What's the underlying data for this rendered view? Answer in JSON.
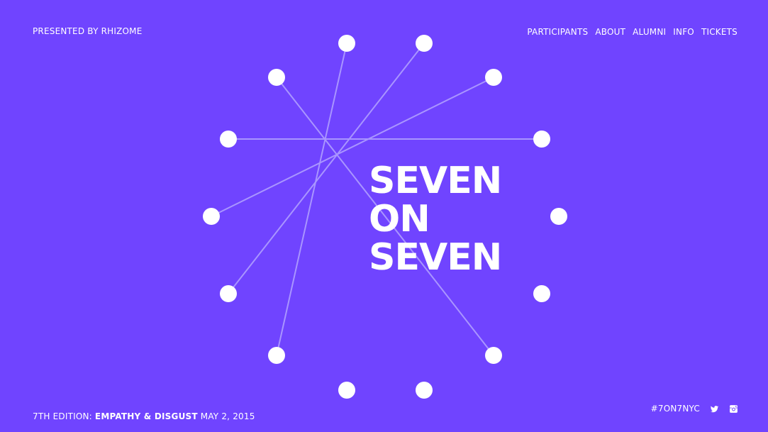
{
  "header": {
    "presented_by": "PRESENTED BY RHIZOME",
    "nav": [
      {
        "label": "PARTICIPANTS"
      },
      {
        "label": "ABOUT"
      },
      {
        "label": "ALUMNI"
      },
      {
        "label": "INFO"
      },
      {
        "label": "TICKETS"
      }
    ]
  },
  "title": {
    "line1": "SEVEN",
    "line2": "ON",
    "line3": "SEVEN"
  },
  "footer": {
    "edition": "7TH EDITION:",
    "theme": "EMPATHY & DISGUST",
    "date": "MAY 2, 2015",
    "hashtag": "#7ON7NYC",
    "social_icons": [
      "twitter-icon",
      "instagram-icon"
    ]
  },
  "colors": {
    "background": "#7044ff",
    "line": "#a995ff",
    "dot": "#ffffff"
  }
}
